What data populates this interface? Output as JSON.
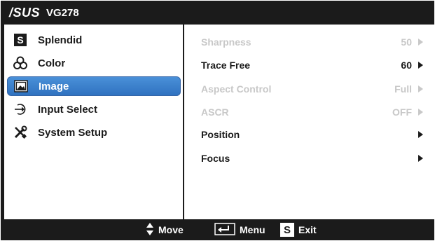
{
  "header": {
    "brand": "/SUS",
    "model": "VG278"
  },
  "left_menu": [
    {
      "label": "Splendid",
      "icon": "splendid-s-icon"
    },
    {
      "label": "Color",
      "icon": "color-circles-icon"
    },
    {
      "label": "Image",
      "icon": "image-icon",
      "selected": true
    },
    {
      "label": "Input Select",
      "icon": "input-arrow-icon"
    },
    {
      "label": "System Setup",
      "icon": "tools-icon"
    }
  ],
  "right_menu": [
    {
      "label": "Sharpness",
      "value": "50",
      "enabled": false
    },
    {
      "label": "Trace Free",
      "value": "60",
      "enabled": true
    },
    {
      "label": "Aspect Control",
      "value": "Full",
      "enabled": false
    },
    {
      "label": "ASCR",
      "value": "OFF",
      "enabled": false
    },
    {
      "label": "Position",
      "value": "",
      "enabled": true
    },
    {
      "label": "Focus",
      "value": "",
      "enabled": true
    }
  ],
  "footer": {
    "move_label": "Move",
    "menu_label": "Menu",
    "exit_label": "Exit",
    "exit_key": "S"
  },
  "colors": {
    "background": "#1b1b1b",
    "panel": "#ffffff",
    "selection": "#3b7fcf",
    "disabled_text": "#c8c8c8"
  }
}
